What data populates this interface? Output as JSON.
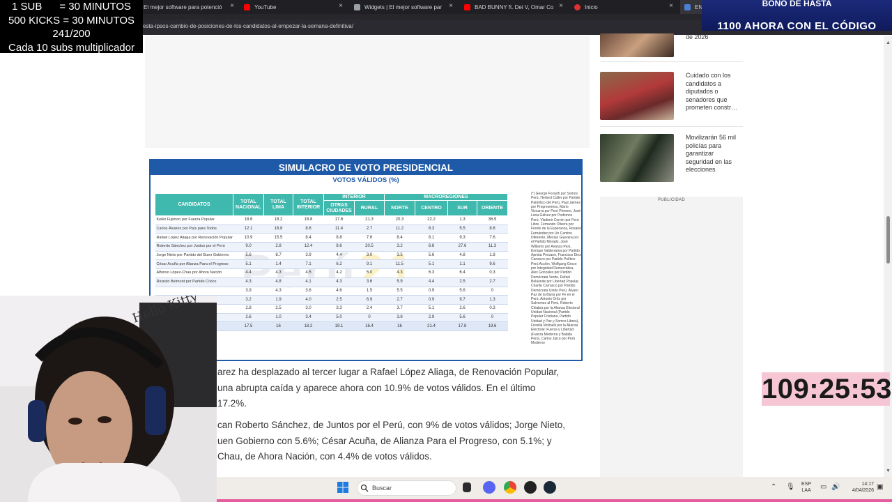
{
  "browser": {
    "tabs": [
      {
        "title": "El mejor software para potenció",
        "icon_color": "#7b61ff"
      },
      {
        "title": "YouTube",
        "icon_color": "#ff0000"
      },
      {
        "title": "Widgets | El mejor software par",
        "icon_color": "#9aa0a6"
      },
      {
        "title": "BAD BUNNY ft. Dei V, Omar Co",
        "icon_color": "#ff0000"
      },
      {
        "title": "Inicio",
        "icon_color": "#e0302f"
      },
      {
        "title": "EN",
        "icon_color": "#4a7fd6"
      }
    ],
    "url": "esta-ipsos-cambio-de-posiciones-de-los-candidatos-al-empezar-la-semana-definitiva/"
  },
  "stream_overlay": {
    "lines": [
      "1 SUB      = 30 MINUTOS",
      "500 KICKS = 30 MINUTOS",
      "241/200",
      "Cada 10 subs multiplicador"
    ],
    "promo_top": "BONO DE HASTA",
    "promo_bottom": "1100 AHORA CON EL CÓDIGO",
    "timer": "109:25:53"
  },
  "sidebar": {
    "news": [
      {
        "title": "de 2026"
      },
      {
        "title": "Cuidado con los candidatos a diputados o senadores que prometen constr…"
      },
      {
        "title": "Movilizarán 56 mil policías para garantizar seguridad en las elecciones"
      }
    ],
    "publicidad_label": "PUBLICIDAD"
  },
  "infographic": {
    "title": "SIMULACRO DE VOTO PRESIDENCIAL",
    "subtitle": "VOTOS VÁLIDOS (%)",
    "watermark_a": "Perú",
    "watermark_b": "21",
    "group_headers": {
      "interior": "INTERIOR",
      "macro": "MACROREGIONES"
    },
    "columns": [
      "CANDIDATOS",
      "TOTAL NACIONAL",
      "TOTAL LIMA",
      "TOTAL INTERIOR",
      "OTRAS CIUDADES",
      "RURAL",
      "NORTE",
      "CENTRO",
      "SUR",
      "ORIENTE"
    ],
    "rows": [
      [
        "Keiko Fujimori por Fuerza Popular",
        "18.6",
        "18.2",
        "18.8",
        "17.6",
        "21.3",
        "20.3",
        "22.2",
        "1.3",
        "36.9"
      ],
      [
        "Carlos Álvarez por País para Todos",
        "12.1",
        "18.8",
        "8.6",
        "11.4",
        "2.7",
        "11.2",
        "8.3",
        "5.5",
        "8.6"
      ],
      [
        "Rafael López Aliaga por Renovación Popular",
        "10.9",
        "15.5",
        "8.4",
        "8.8",
        "7.6",
        "8.4",
        "8.1",
        "9.3",
        "7.6"
      ],
      [
        "Roberto Sánchez por Juntos por el Perú",
        "9.0",
        "2.8",
        "12.4",
        "8.6",
        "20.5",
        "3.2",
        "8.8",
        "27.6",
        "11.3"
      ],
      [
        "Jorge Nieto por Partido del Buen Gobierno",
        "5.6",
        "8.7",
        "3.9",
        "4.4",
        "3.0",
        "3.5",
        "5.6",
        "4.8",
        "1.8"
      ],
      [
        "César Acuña por Alianza Para el Progreso",
        "5.1",
        "1.4",
        "7.1",
        "6.2",
        "9.1",
        "11.5",
        "5.1",
        "1.1",
        "9.6"
      ],
      [
        "Alfonso López-Chau por Ahora Nación",
        "4.4",
        "4.3",
        "4.5",
        "4.2",
        "5.0",
        "4.3",
        "6.3",
        "6.4",
        "0.3"
      ],
      [
        "Ricardo Belmont por Partido Cívico",
        "4.3",
        "4.8",
        "4.1",
        "4.3",
        "3.6",
        "5.9",
        "4.4",
        "2.5",
        "2.7"
      ],
      [
        "",
        "3.9",
        "4.3",
        "3.6",
        "4.6",
        "1.5",
        "5.5",
        "0.9",
        "5.6",
        "0"
      ],
      [
        "",
        "3.2",
        "1.9",
        "4.0",
        "2.5",
        "6.9",
        "2.7",
        "0.9",
        "9.7",
        "1.3"
      ],
      [
        "",
        "2.8",
        "2.5",
        "3.0",
        "3.3",
        "2.4",
        "3.7",
        "5.1",
        "2.6",
        "0.3"
      ],
      [
        "",
        "2.6",
        "1.0",
        "3.4",
        "5.0",
        "0",
        "3.8",
        "2.9",
        "5.6",
        "0"
      ],
      [
        "",
        "17.5",
        "16",
        "18.2",
        "19.1",
        "16.4",
        "16",
        "21.4",
        "17.8",
        "19.6"
      ]
    ],
    "notes": "(*) George Forsyth por Somos Perú, Herbert Caller por Partido Patriótico del Perú, Paul Jaimes por Progresemos, Mario Vizcarra por Perú Primero, José Luna Gálvez por Podemos Perú, Vladimir Cerrón por Perú Libre, Fernando Olivera por Frente de la Esperanza, Rosario Fernández por Un Camino Diferente, Mesías Guevara por el Partido Morado, José Williams por Avanza País, Enrique Valderrama por Partido Aprista Peruano, Francisco Diez Canseco por Partido Político Perú Acción, Wolfgang Grozo por Integridad Democrática, Alex Gonzales por Partido Demócrata Verde, Rafael Belaunde por Libertad Popular, Charlie Carrasco por Partido Demócrata Unido Perú, Álvaro Paz de la Barra por Fe en el Perú, Antonio Ortiz por Salvemos al Perú, Roberto Chiabra por la Alianza Electoral Unidad Nacional (Partido Popular Cristiano, Partido Unidad y Paz y Somos Libres), Fiorella Molinelli por la Alianza Electoral: Fuerza y Libertad (Fuerza Moderna y Batalla Perú), Carlos Jaico por Perú Moderno"
  },
  "article": {
    "para1": [
      "arez ha desplazado al tercer lugar a Rafael López Aliaga, de Renovación Popular,",
      "una abrupta caída y aparece ahora con 10.9% de votos válidos. En el último",
      "17.2%."
    ],
    "para2": [
      "can Roberto Sánchez, de Juntos por el Perú, con 9% de votos válidos; Jorge Nieto,",
      "uen Gobierno con 5.6%; César Acuña, de Alianza Para el Progreso, con 5.1%; y",
      "Chau, de Ahora Nación, con 4.4% de votos válidos."
    ]
  },
  "taskbar": {
    "search_placeholder": "Buscar",
    "lang_top": "ESP",
    "lang_bottom": "LAA",
    "time": "14:17",
    "date": "4/04/2026"
  }
}
